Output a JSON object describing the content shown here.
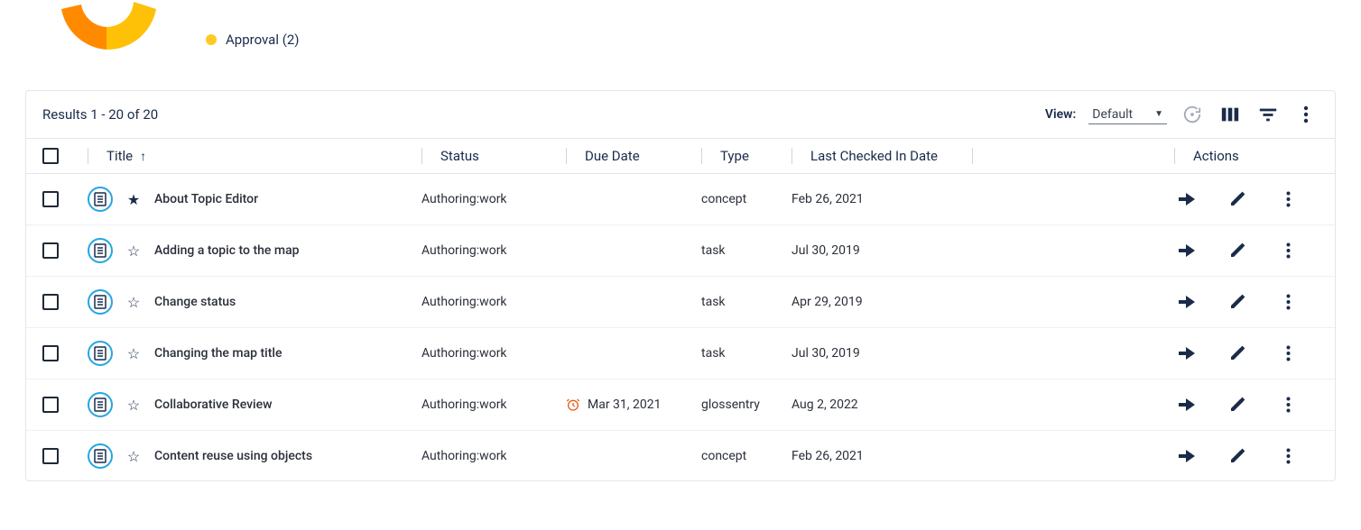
{
  "legend": {
    "approval_label": "Approval (2)"
  },
  "toolbar": {
    "results": "Results 1 - 20 of 20",
    "view_label": "View:",
    "view_value": "Default"
  },
  "columns": {
    "title": "Title",
    "status": "Status",
    "due": "Due Date",
    "type": "Type",
    "checked": "Last Checked In Date",
    "actions": "Actions"
  },
  "rows": [
    {
      "title": "About Topic Editor",
      "starred": true,
      "status": "Authoring:work",
      "due": "",
      "alarm": false,
      "type": "concept",
      "checked": "Feb 26, 2021"
    },
    {
      "title": "Adding a topic to the map",
      "starred": false,
      "status": "Authoring:work",
      "due": "",
      "alarm": false,
      "type": "task",
      "checked": "Jul 30, 2019"
    },
    {
      "title": "Change status",
      "starred": false,
      "status": "Authoring:work",
      "due": "",
      "alarm": false,
      "type": "task",
      "checked": "Apr 29, 2019"
    },
    {
      "title": "Changing the map title",
      "starred": false,
      "status": "Authoring:work",
      "due": "",
      "alarm": false,
      "type": "task",
      "checked": "Jul 30, 2019"
    },
    {
      "title": "Collaborative Review",
      "starred": false,
      "status": "Authoring:work",
      "due": "Mar 31, 2021",
      "alarm": true,
      "type": "glossentry",
      "checked": "Aug 2, 2022"
    },
    {
      "title": "Content reuse using objects",
      "starred": false,
      "status": "Authoring:work",
      "due": "",
      "alarm": false,
      "type": "concept",
      "checked": "Feb 26, 2021"
    }
  ]
}
